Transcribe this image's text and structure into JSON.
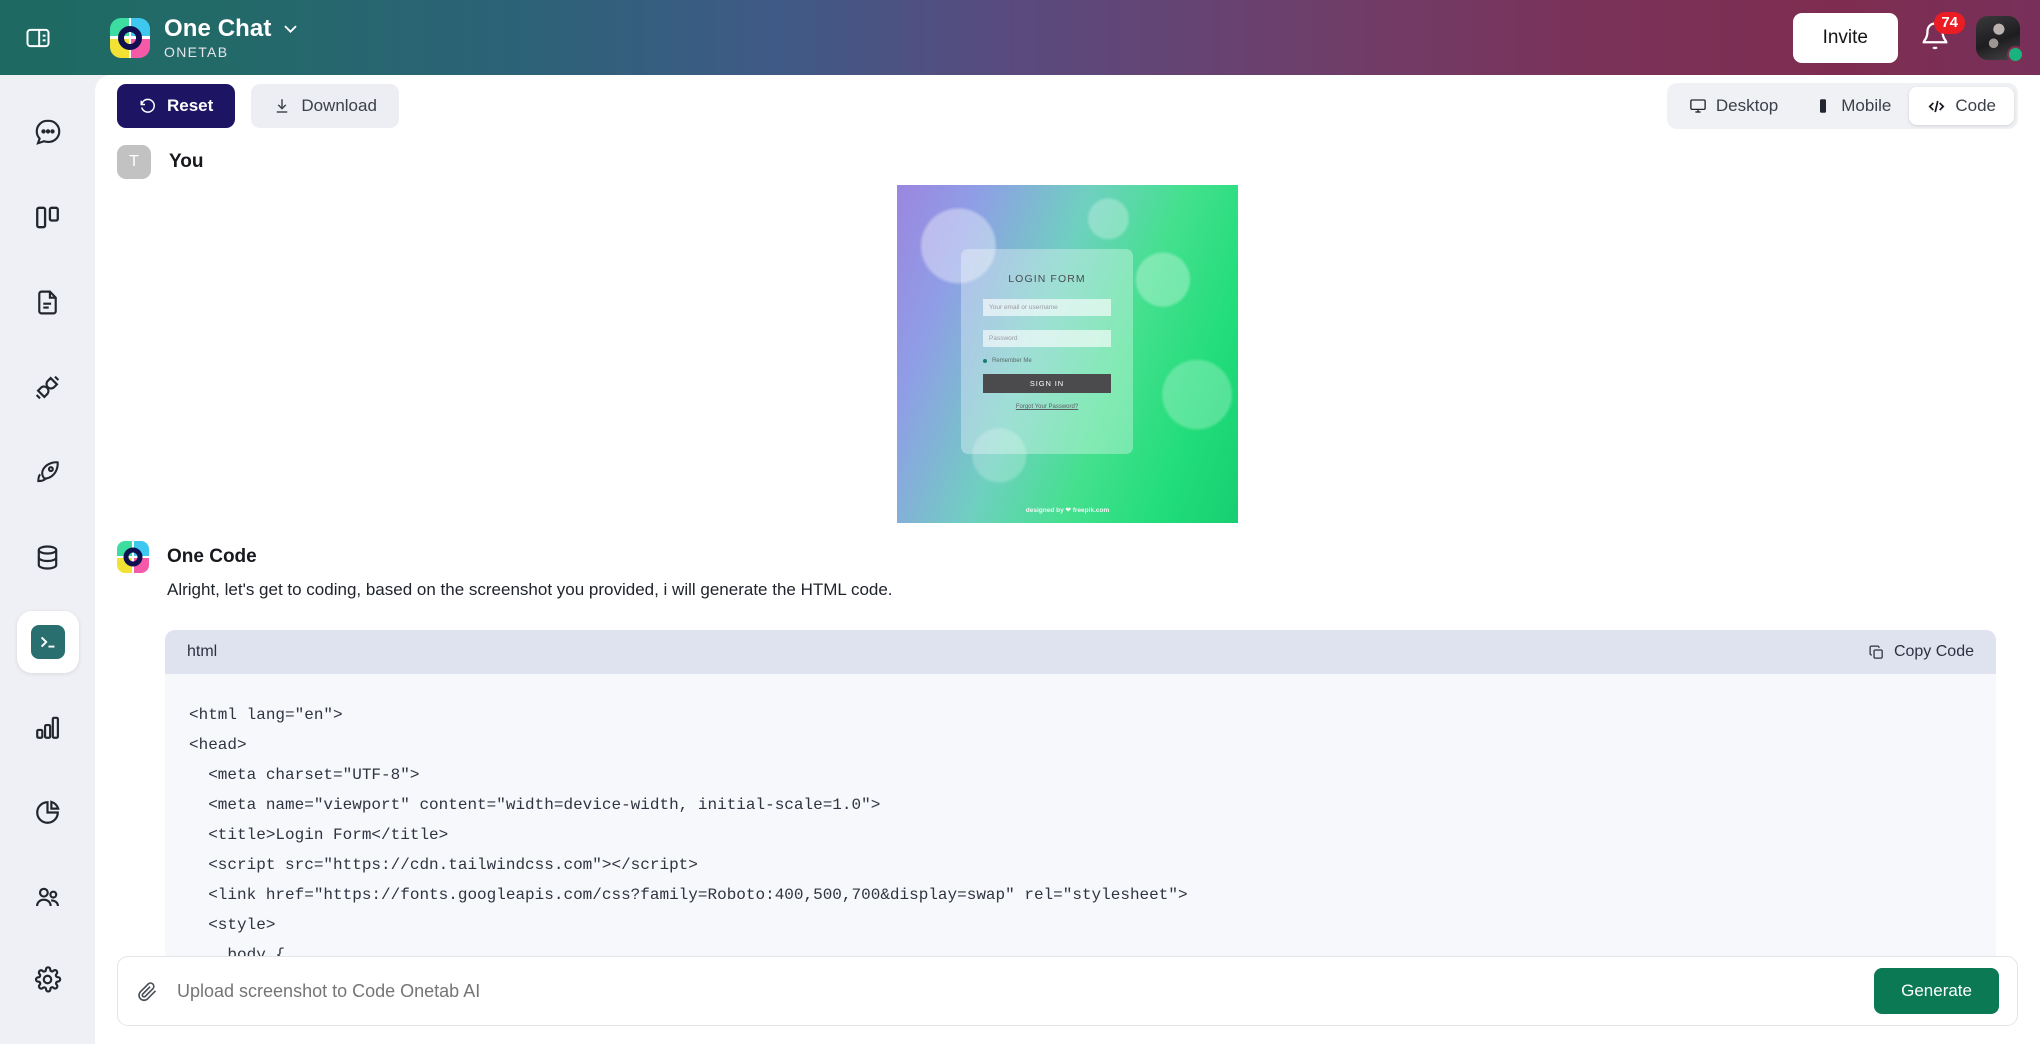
{
  "topbar": {
    "panel_toggle_icon": "panel-layout-icon",
    "brand_title": "One Chat",
    "brand_subtitle": "ONETAB",
    "chevron_icon": "chevron-down-icon",
    "invite_label": "Invite",
    "bell_icon": "bell-icon",
    "notification_count": "74",
    "avatar_icon": "user-avatar",
    "status": "online",
    "gradient_from": "#1e6a63",
    "gradient_to": "#7e2d50"
  },
  "sidebar": {
    "items": [
      {
        "name": "sidebar-item-chat",
        "icon": "chat-bubble-icon",
        "active": false
      },
      {
        "name": "sidebar-item-columns",
        "icon": "columns-icon",
        "active": false
      },
      {
        "name": "sidebar-item-document",
        "icon": "document-icon",
        "active": false
      },
      {
        "name": "sidebar-item-integrations",
        "icon": "plug-icon",
        "active": false
      },
      {
        "name": "sidebar-item-launch",
        "icon": "rocket-icon",
        "active": false
      },
      {
        "name": "sidebar-item-database",
        "icon": "database-icon",
        "active": false
      },
      {
        "name": "sidebar-item-code",
        "icon": "terminal-icon",
        "active": true
      },
      {
        "name": "sidebar-item-analytics",
        "icon": "bar-chart-icon",
        "active": false
      },
      {
        "name": "sidebar-item-reports",
        "icon": "pie-chart-icon",
        "active": false
      },
      {
        "name": "sidebar-item-team",
        "icon": "users-icon",
        "active": false
      }
    ],
    "bottom_item": {
      "name": "sidebar-item-settings",
      "icon": "gear-icon"
    },
    "active_tile_color": "#2a6f70"
  },
  "toolbar": {
    "reset_label": "Reset",
    "reset_icon": "rotate-left-icon",
    "reset_color": "#1d1464",
    "download_label": "Download",
    "download_icon": "download-icon",
    "views": [
      {
        "label": "Desktop",
        "icon": "monitor-icon",
        "active": false
      },
      {
        "label": "Mobile",
        "icon": "phone-icon",
        "active": false
      },
      {
        "label": "Code",
        "icon": "code-brackets-icon",
        "active": true
      }
    ]
  },
  "conversation": {
    "user_message": {
      "avatar_initial": "T",
      "sender": "You",
      "attachment": {
        "name": "login-form-screenshot",
        "title": "LOGIN FORM",
        "email_placeholder": "Your email or username",
        "password_placeholder": "Password",
        "remember_label": "Remember Me",
        "submit_label": "SIGN IN",
        "forgot_label": "Forgot Your Password?",
        "credit": "designed by ❤ freepik.com"
      }
    },
    "assistant_message": {
      "sender": "One Code",
      "text": "Alright, let's get to coding, based on the screenshot you provided, i will generate the HTML code."
    },
    "code_block": {
      "language": "html",
      "copy_label": "Copy Code",
      "copy_icon": "copy-icon",
      "code": "<html lang=\"en\">\n<head>\n  <meta charset=\"UTF-8\">\n  <meta name=\"viewport\" content=\"width=device-width, initial-scale=1.0\">\n  <title>Login Form</title>\n  <script src=\"https://cdn.tailwindcss.com\"></script>\n  <link href=\"https://fonts.googleapis.com/css?family=Roboto:400,500,700&display=swap\" rel=\"stylesheet\">\n  <style>\n    body {\n      font-family: 'Roboto', sans-serif;\n      background-image: linear-gradient(120deg, #a1c4fd 0%, #c2e9fb 100%);"
    }
  },
  "composer": {
    "attach_icon": "paperclip-icon",
    "placeholder": "Upload screenshot to Code Onetab AI",
    "value": "",
    "generate_label": "Generate",
    "generate_color": "#0b7a54"
  }
}
